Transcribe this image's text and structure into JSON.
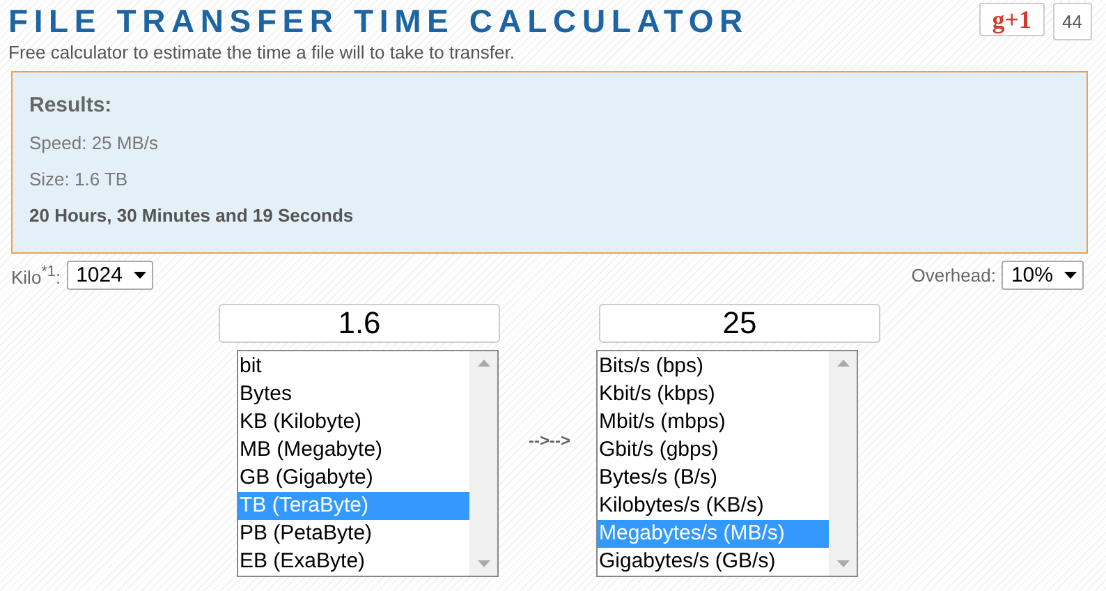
{
  "header": {
    "title": "FILE TRANSFER TIME CALCULATOR",
    "subtitle": "Free calculator to estimate the time a file will to take to transfer.",
    "share_button": "g+1",
    "share_count": "44"
  },
  "results": {
    "heading": "Results:",
    "speed": "Speed: 25 MB/s",
    "size": "Size: 1.6 TB",
    "duration": "20 Hours, 30 Minutes and 19 Seconds"
  },
  "options": {
    "kilo_label": "Kilo$^{*1}$:",
    "kilo_value": "1024",
    "overhead_label": "Overhead:",
    "overhead_value": "10%"
  },
  "size": {
    "value": "1.6",
    "units": [
      {
        "label": "bit",
        "selected": false
      },
      {
        "label": "Bytes",
        "selected": false
      },
      {
        "label": "KB (Kilobyte)",
        "selected": false
      },
      {
        "label": "MB (Megabyte)",
        "selected": false
      },
      {
        "label": "GB (Gigabyte)",
        "selected": false
      },
      {
        "label": "TB (TeraByte)",
        "selected": true
      },
      {
        "label": "PB (PetaByte)",
        "selected": false
      },
      {
        "label": "EB (ExaByte)",
        "selected": false
      }
    ]
  },
  "arrow": "-->-->",
  "speed": {
    "value": "25",
    "units": [
      {
        "label": "Bits/s (bps)",
        "selected": false
      },
      {
        "label": "Kbit/s (kbps)",
        "selected": false
      },
      {
        "label": "Mbit/s (mbps)",
        "selected": false
      },
      {
        "label": "Gbit/s (gbps)",
        "selected": false
      },
      {
        "label": "Bytes/s (B/s)",
        "selected": false
      },
      {
        "label": "Kilobytes/s (KB/s)",
        "selected": false
      },
      {
        "label": "Megabytes/s (MB/s)",
        "selected": true
      },
      {
        "label": "Gigabytes/s (GB/s)",
        "selected": false
      }
    ]
  }
}
